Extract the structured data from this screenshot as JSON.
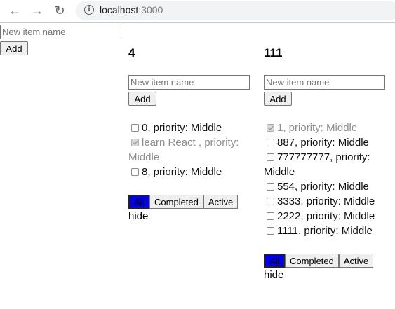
{
  "browser": {
    "url_host": "localhost",
    "url_port": ":3000"
  },
  "top": {
    "input_placeholder": "New item name",
    "add_label": "Add"
  },
  "lists": [
    {
      "title": "4",
      "input_placeholder": "New item name",
      "add_label": "Add",
      "items": [
        {
          "label": "0, priority: Middle",
          "done": false
        },
        {
          "label": "learn React , priority:",
          "label2": "Middle",
          "done": true
        },
        {
          "label": "8, priority: Middle",
          "done": false
        }
      ],
      "filters": [
        "All",
        "Completed",
        "Active"
      ],
      "active_filter": "All",
      "hide_label": "hide"
    },
    {
      "title": "111",
      "input_placeholder": "New item name",
      "add_label": "Add",
      "items": [
        {
          "label": "1, priority: Middle",
          "done": true
        },
        {
          "label": "887, priority: Middle",
          "done": false
        },
        {
          "label": "777777777, priority:",
          "label2": "Middle",
          "done": false
        },
        {
          "label": "554, priority: Middle",
          "done": false
        },
        {
          "label": "3333, priority: Middle",
          "done": false
        },
        {
          "label": "2222, priority: Middle",
          "done": false
        },
        {
          "label": "1111, priority: Middle",
          "done": false
        }
      ],
      "filters": [
        "All",
        "Completed",
        "Active"
      ],
      "active_filter": "All",
      "hide_label": "hide"
    }
  ],
  "colors": {
    "active_filter_bg": "#0000ee",
    "done_text": "#8e8e8e"
  }
}
